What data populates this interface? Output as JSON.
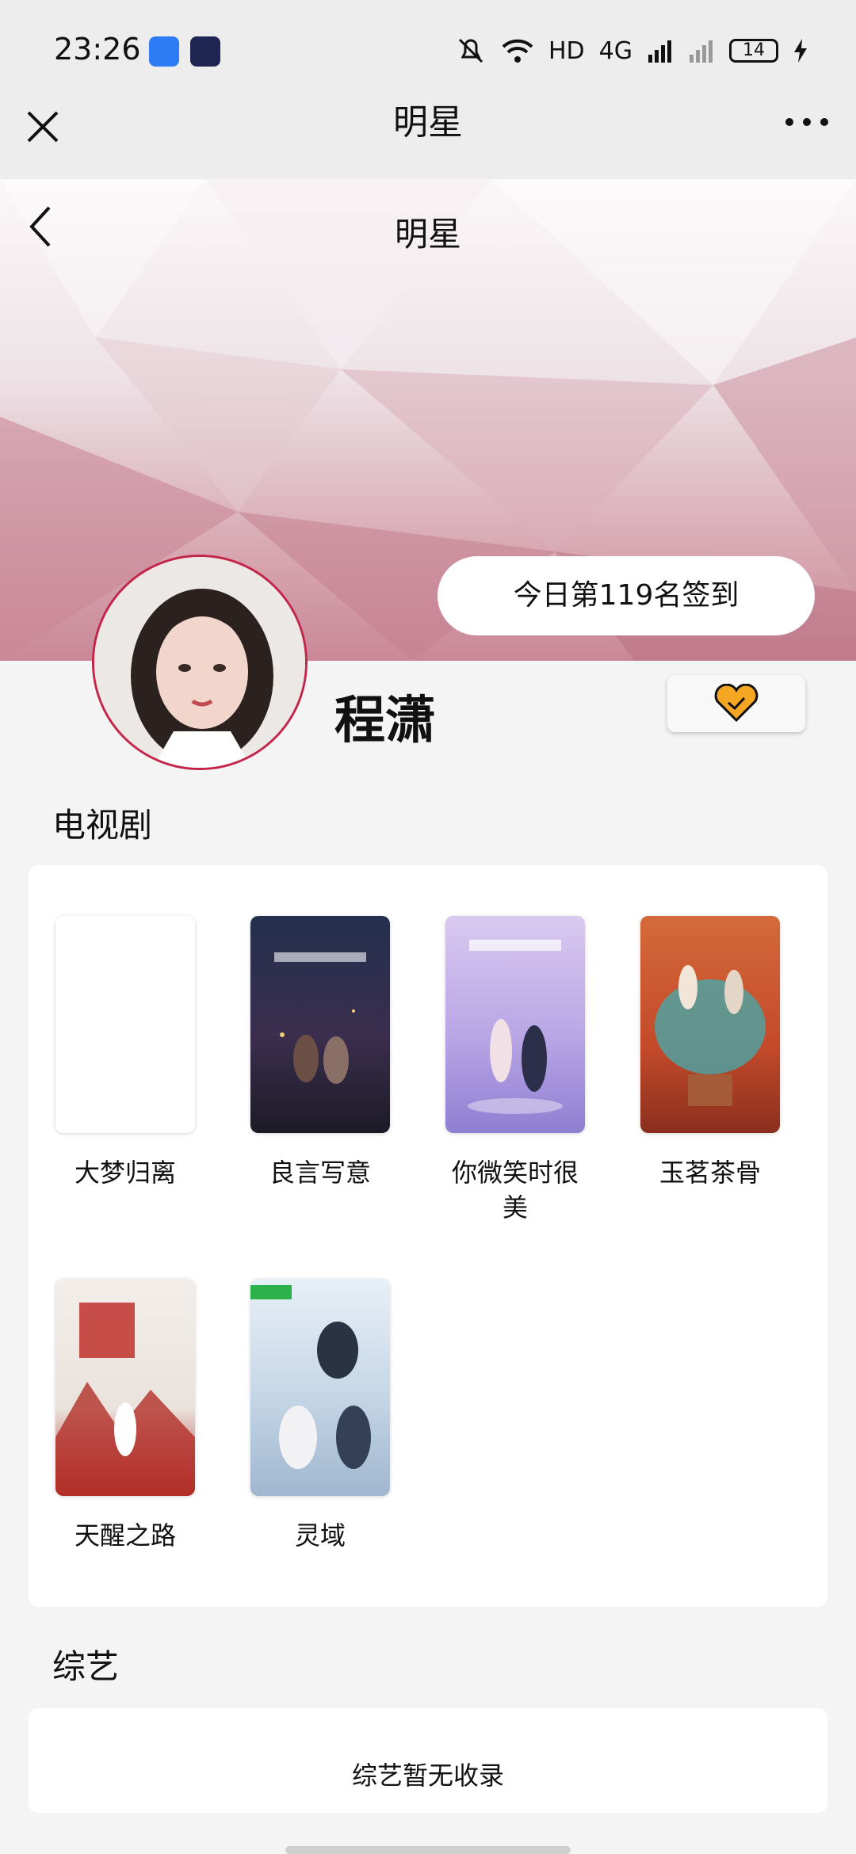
{
  "status_bar": {
    "time": "23:26",
    "network": "HD",
    "signal": "4G",
    "battery": "14"
  },
  "nav": {
    "title": "明星"
  },
  "banner": {
    "title": "明星",
    "checkin_label": "今日第119名签到"
  },
  "profile": {
    "name": "程潇"
  },
  "tv_section": {
    "title": "电视剧",
    "items": [
      {
        "title": "大梦归离"
      },
      {
        "title": "良言写意"
      },
      {
        "title": "你微笑时很美"
      },
      {
        "title": "玉茗茶骨"
      },
      {
        "title": "天醒之路"
      },
      {
        "title": "灵域"
      }
    ]
  },
  "variety_section": {
    "title": "综艺",
    "empty_text": "综艺暂无收录"
  },
  "colors": {
    "accent_red": "#c4264a",
    "heart": "#f5a623"
  }
}
